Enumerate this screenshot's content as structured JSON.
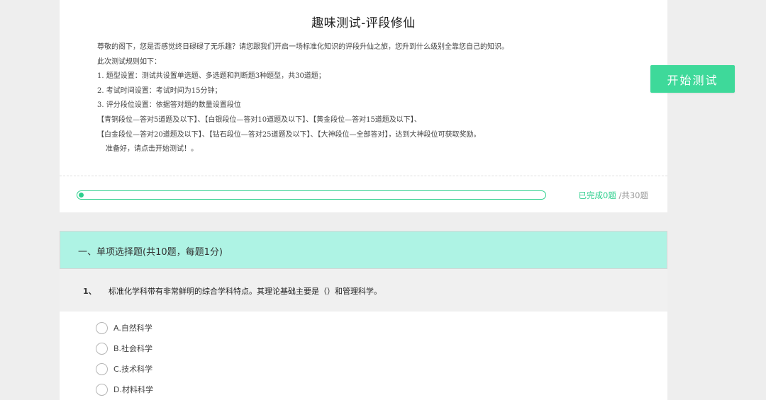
{
  "quiz": {
    "title": "趣味测试-评段修仙",
    "description": [
      "尊敬的阁下，您是否感觉终日碌碌了无乐趣？请您跟我们开启一场标准化知识的评段升仙之旅，您升到什么级别全靠您自己的知识。",
      "此次测试规则如下：",
      "1. 题型设置：测试共设置单选题、多选题和判断题3种题型，共30道题；",
      "2. 考试时间设置：考试时间为15分钟；",
      "3. 评分段位设置：依据答对题的数量设置段位",
      "【青铜段位—答对5道题及以下】、【白银段位—答对10道题及以下】、【黄金段位—答对15道题及以下】、",
      "【白金段位—答对20道题及以下】、【钻石段位—答对25道题及以下】、【大神段位—全部答对】，达到大神段位可获取奖励。",
      "准备好，请点击开始测试！。"
    ],
    "progress": {
      "completed_text": "已完成0题",
      "total_text": "/共30题",
      "completed": 0,
      "total": 30
    },
    "start_button_label": "开始测试"
  },
  "section": {
    "title": "一、单项选择题(共10题，每题1分)"
  },
  "question": {
    "number": "1、",
    "text": "标准化学科带有非常鲜明的综合学科特点。其理论基础主要是（）和管理科学。",
    "options": [
      {
        "label": "A.自然科学"
      },
      {
        "label": "B.社会科学"
      },
      {
        "label": "C.技术科学"
      },
      {
        "label": "D.材料科学"
      }
    ]
  },
  "colors": {
    "accent": "#2dcf8d",
    "button": "#3ed99a",
    "section_header": "#aef3e4",
    "page_background": "#eeeeee"
  }
}
